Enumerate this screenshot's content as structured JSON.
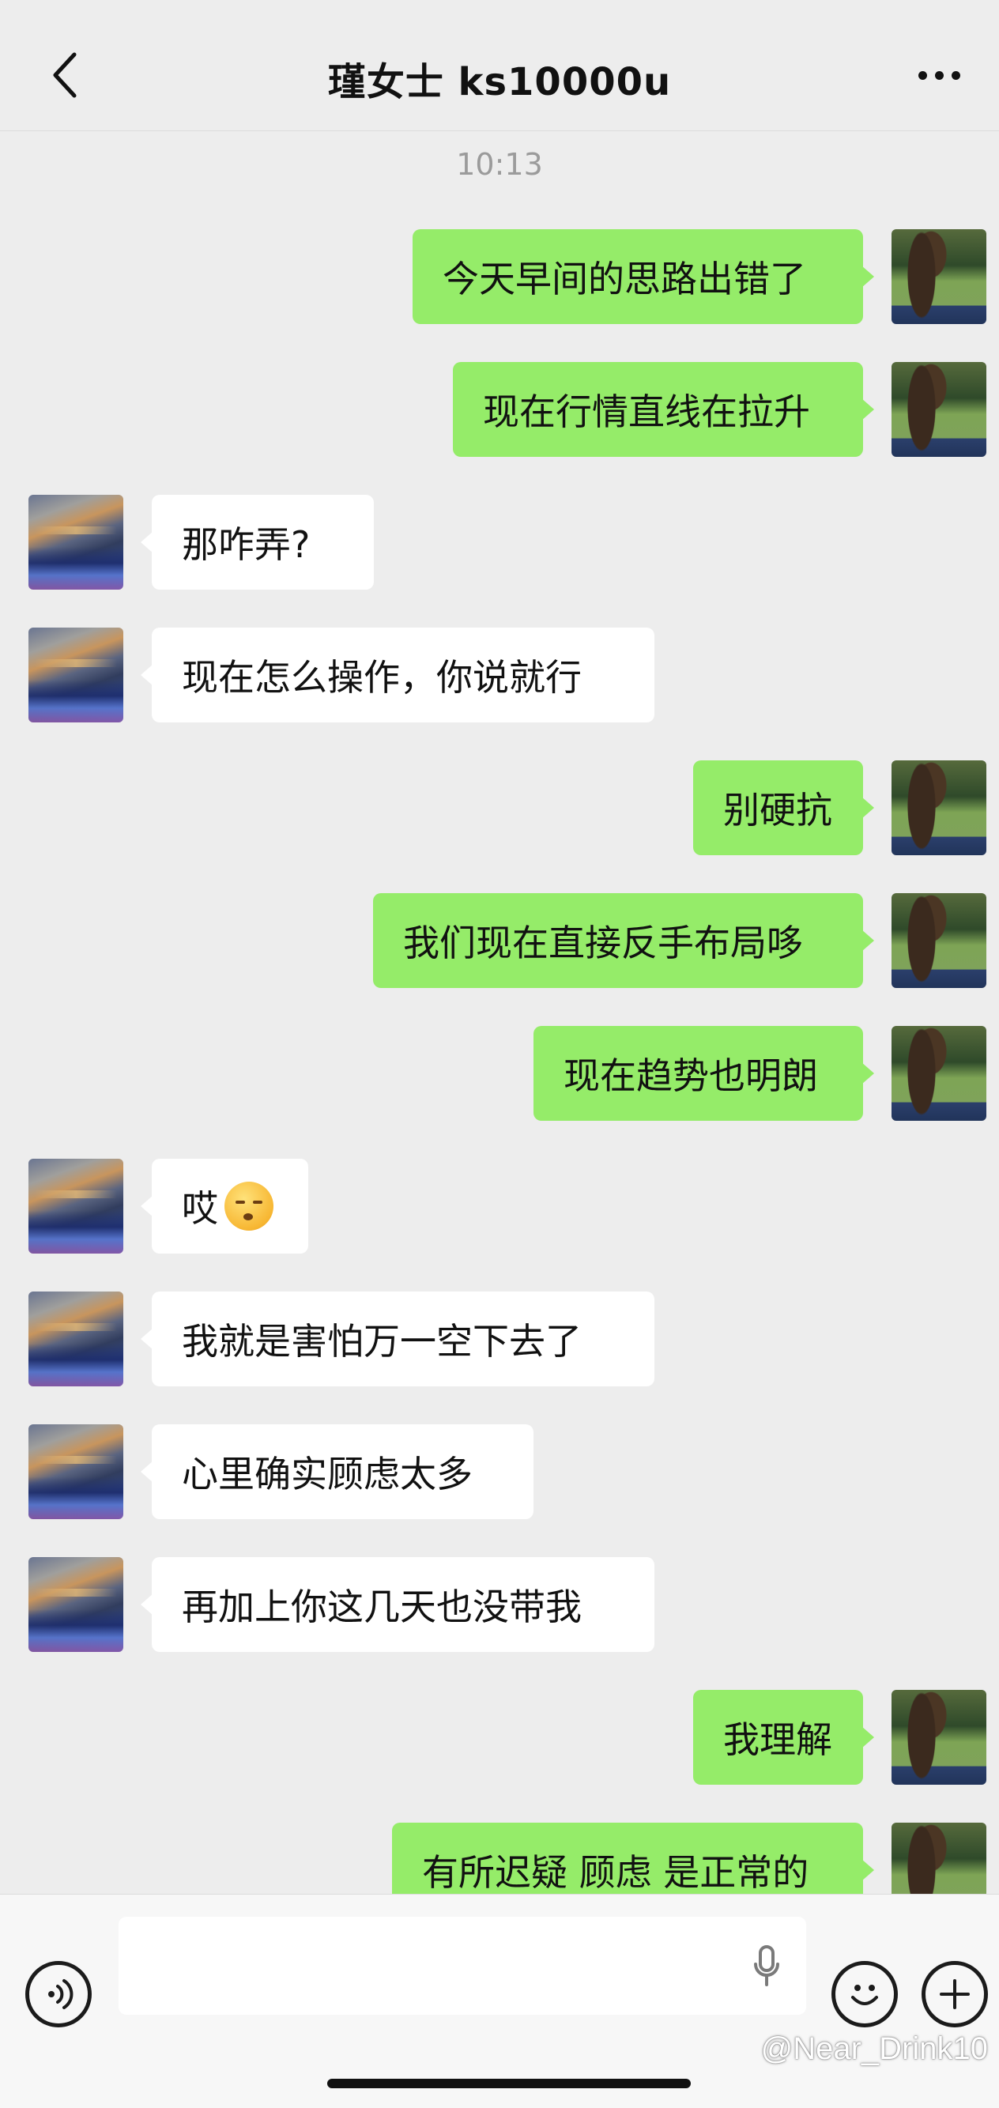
{
  "header": {
    "title": "瑾女士 ks10000u"
  },
  "timestamp": "10:13",
  "messages": [
    {
      "side": "sent",
      "text": "今天早间的思路出错了"
    },
    {
      "side": "sent",
      "text": "现在行情直线在拉升"
    },
    {
      "side": "received",
      "text": "那咋弄?"
    },
    {
      "side": "received",
      "text": "现在怎么操作，你说就行"
    },
    {
      "side": "sent",
      "text": "别硬抗"
    },
    {
      "side": "sent",
      "text": "我们现在直接反手布局哆"
    },
    {
      "side": "sent",
      "text": "现在趋势也明朗"
    },
    {
      "side": "received",
      "text": "哎",
      "emoji": "exhale-face"
    },
    {
      "side": "received",
      "text": "我就是害怕万一空下去了"
    },
    {
      "side": "received",
      "text": "心里确实顾虑太多"
    },
    {
      "side": "received",
      "text": "再加上你这几天也没带我"
    },
    {
      "side": "sent",
      "text": "我理解"
    },
    {
      "side": "sent",
      "text": "有所迟疑 顾虑 是正常的"
    }
  ],
  "input": {
    "value": "",
    "placeholder": ""
  },
  "watermark": "@Near_Drink10",
  "colors": {
    "background": "#ededed",
    "sent_bubble": "#95ec69",
    "received_bubble": "#ffffff",
    "timestamp": "#9b9b9b"
  },
  "icons": [
    "back-arrow-icon",
    "more-icon",
    "voice-icon",
    "mic-icon",
    "emoji-icon",
    "plus-icon"
  ]
}
